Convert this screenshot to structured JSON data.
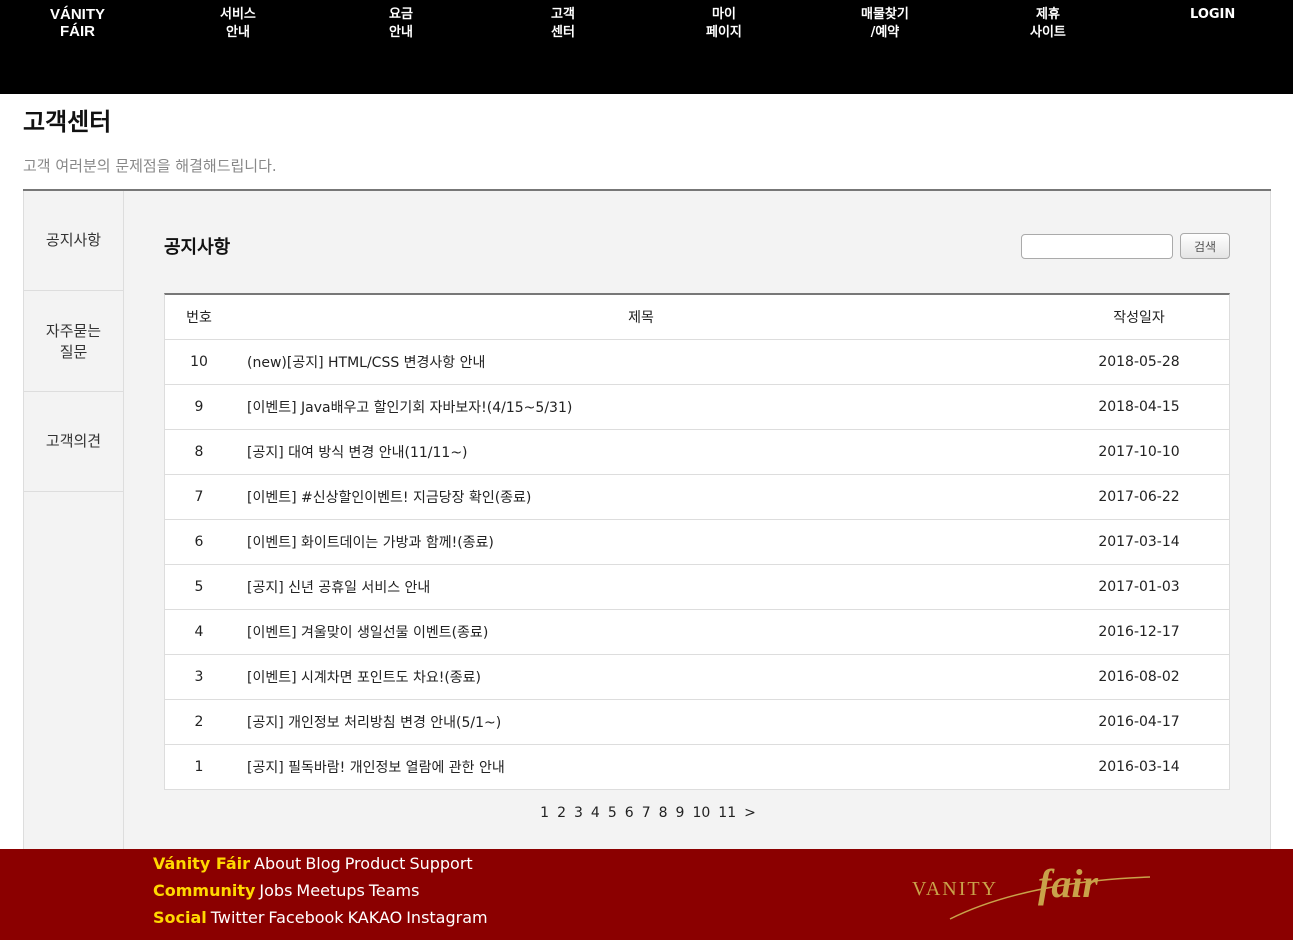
{
  "nav": {
    "brand": [
      "VÁNITY",
      "FÁIR"
    ],
    "items": [
      {
        "l1": "서비스",
        "l2": "안내"
      },
      {
        "l1": "요금",
        "l2": "안내"
      },
      {
        "l1": "고객",
        "l2": "센터"
      },
      {
        "l1": "마이",
        "l2": "페이지"
      },
      {
        "l1": "매물찾기",
        "l2": "/예약"
      },
      {
        "l1": "제휴",
        "l2": "사이트"
      }
    ],
    "login": "LOGIN"
  },
  "header": {
    "title": "고객센터",
    "subtitle": "고객 여러분의 문제점을 해결해드립니다."
  },
  "sidebar": {
    "items": [
      {
        "line1": "공지사항",
        "line2": ""
      },
      {
        "line1": "자주묻는",
        "line2": "질문"
      },
      {
        "line1": "고객의견",
        "line2": ""
      }
    ]
  },
  "main": {
    "section_title": "공지사항",
    "search": {
      "placeholder": "",
      "button": "검색"
    },
    "table": {
      "headers": [
        "번호",
        "제목",
        "작성일자"
      ],
      "rows": [
        {
          "no": "10",
          "title": "(new)[공지] HTML/CSS 변경사항 안내",
          "date": "2018-05-28"
        },
        {
          "no": "9",
          "title": "[이벤트] Java배우고 할인기회 자바보자!(4/15~5/31)",
          "date": "2018-04-15"
        },
        {
          "no": "8",
          "title": "[공지] 대여 방식 변경 안내(11/11~)",
          "date": "2017-10-10"
        },
        {
          "no": "7",
          "title": "[이벤트] #신상할인이벤트! 지금당장 확인(종료)",
          "date": "2017-06-22"
        },
        {
          "no": "6",
          "title": "[이벤트] 화이트데이는 가방과 함께!(종료)",
          "date": "2017-03-14"
        },
        {
          "no": "5",
          "title": "[공지] 신년 공휴일 서비스 안내",
          "date": "2017-01-03"
        },
        {
          "no": "4",
          "title": "[이벤트] 겨울맞이 생일선물 이벤트(종료)",
          "date": "2016-12-17"
        },
        {
          "no": "3",
          "title": "[이벤트] 시계차면 포인트도 차요!(종료)",
          "date": "2016-08-02"
        },
        {
          "no": "2",
          "title": "[공지] 개인정보 처리방침 변경 안내(5/1~)",
          "date": "2016-04-17"
        },
        {
          "no": "1",
          "title": "[공지] 필독바람! 개인정보 열람에 관한 안내",
          "date": "2016-03-14"
        }
      ]
    },
    "pagination": [
      "1",
      "2",
      "3",
      "4",
      "5",
      "6",
      "7",
      "8",
      "9",
      "10",
      "11",
      ">"
    ]
  },
  "footer": {
    "lines": [
      {
        "label": "Vánity Fáir",
        "links": [
          "About",
          "Blog",
          "Product",
          "Support"
        ]
      },
      {
        "label": "Community",
        "links": [
          "Jobs",
          "Meetups",
          "Teams"
        ]
      },
      {
        "label": "Social",
        "links": [
          "Twitter",
          "Facebook",
          "KAKAO",
          "Instagram"
        ]
      }
    ],
    "logo_text": [
      "VANITY",
      "fair"
    ]
  },
  "colors": {
    "nav_bg": "#000000",
    "footer_bg": "#8b0000",
    "footer_highlight": "#ffd800",
    "logo_gold": "#c9a24a"
  }
}
